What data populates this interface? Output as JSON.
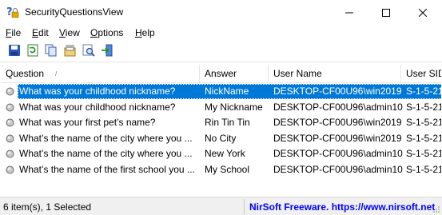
{
  "window": {
    "title": "SecurityQuestionsView"
  },
  "menu": [
    {
      "first": "F",
      "rest": "ile"
    },
    {
      "first": "E",
      "rest": "dit"
    },
    {
      "first": "V",
      "rest": "iew"
    },
    {
      "first": "O",
      "rest": "ptions"
    },
    {
      "first": "H",
      "rest": "elp"
    }
  ],
  "toolbar": {
    "icons": [
      "save-icon",
      "refresh-icon",
      "copy-icon",
      "properties-icon",
      "find-icon",
      "exit-icon"
    ]
  },
  "table": {
    "columns": [
      "Question",
      "Answer",
      "User Name",
      "User SID"
    ],
    "rows": [
      {
        "question": "What was your childhood nickname?",
        "answer": "NickName",
        "user": "DESKTOP-CF00U96\\win2019",
        "sid": "S-1-5-21",
        "selected": true
      },
      {
        "question": "What was your childhood nickname?",
        "answer": "My Nickname",
        "user": "DESKTOP-CF00U96\\admin10",
        "sid": "S-1-5-21",
        "selected": false
      },
      {
        "question": "What was your first pet’s name?",
        "answer": "Rin Tin Tin",
        "user": "DESKTOP-CF00U96\\win2019",
        "sid": "S-1-5-21",
        "selected": false
      },
      {
        "question": "What’s the name of the city where you ...",
        "answer": "No City",
        "user": "DESKTOP-CF00U96\\win2019",
        "sid": "S-1-5-21",
        "selected": false
      },
      {
        "question": "What’s the name of the city where you ...",
        "answer": "New York",
        "user": "DESKTOP-CF00U96\\admin10",
        "sid": "S-1-5-21",
        "selected": false
      },
      {
        "question": "What’s the name of the first school you ...",
        "answer": "My School",
        "user": "DESKTOP-CF00U96\\admin10",
        "sid": "S-1-5-21",
        "selected": false
      }
    ]
  },
  "status": {
    "left": "6 item(s), 1 Selected",
    "right": "NirSoft Freeware. https://www.nirsoft.net"
  },
  "colors": {
    "selection": "#0078d7",
    "link": "#0000ff"
  }
}
